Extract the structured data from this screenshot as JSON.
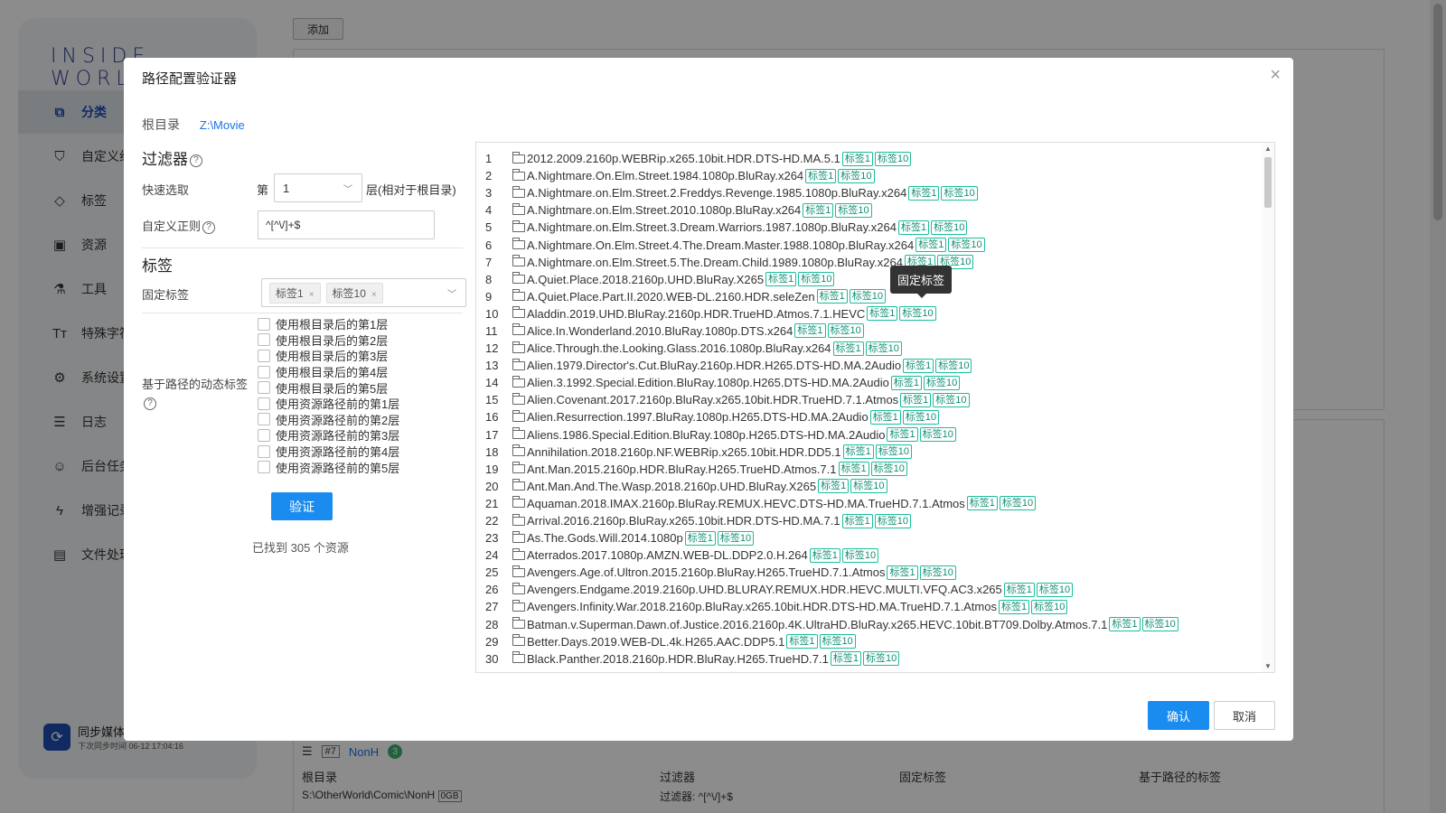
{
  "app": {
    "logo": "INSIDE WORLD",
    "nav": [
      {
        "label": "分类",
        "icon": "category-icon"
      },
      {
        "label": "自定义组",
        "icon": "custom-group-icon"
      },
      {
        "label": "标签",
        "icon": "tag-icon"
      },
      {
        "label": "资源",
        "icon": "image-icon"
      },
      {
        "label": "工具",
        "icon": "flask-icon"
      },
      {
        "label": "特殊字符",
        "icon": "text-icon"
      },
      {
        "label": "系统设置",
        "icon": "gear-icon"
      },
      {
        "label": "日志",
        "icon": "log-icon"
      },
      {
        "label": "后台任务",
        "icon": "bot-icon"
      },
      {
        "label": "增强记录",
        "icon": "bolt-icon"
      },
      {
        "label": "文件处理",
        "icon": "folder-icon"
      }
    ],
    "sync": {
      "title": "同步媒体",
      "subtitle": "下次同步时间 06-12 17:04:16"
    },
    "add_button": "添加",
    "card": {
      "index": "#7",
      "name": "NonH",
      "count": "3",
      "col1": "根目录",
      "col2": "过滤器",
      "col3": "固定标签",
      "col4": "基于路径的标签",
      "path": "S:\\OtherWorld\\Comic\\NonH",
      "size": "0GB",
      "filter": "过滤器: ^[^\\/]+$"
    }
  },
  "dialog": {
    "title": "路径配置验证器",
    "root_label": "根目录",
    "root_value": "Z:\\Movie",
    "filter_title": "过滤器",
    "quick_select_label": "快速选取",
    "level_prefix": "第",
    "level_value": "1",
    "level_suffix": "层(相对于根目录)",
    "regex_label": "自定义正则",
    "regex_value": "^[^\\/]+$",
    "tags_title": "标签",
    "fixed_tags_label": "固定标签",
    "fixed_tags": [
      "标签1",
      "标签10"
    ],
    "dynamic_tags_label": "基于路径的动态标签",
    "checkboxes": [
      "使用根目录后的第1层",
      "使用根目录后的第2层",
      "使用根目录后的第3层",
      "使用根目录后的第4层",
      "使用根目录后的第5层",
      "使用资源路径前的第1层",
      "使用资源路径前的第2层",
      "使用资源路径前的第3层",
      "使用资源路径前的第4层",
      "使用资源路径前的第5层"
    ],
    "verify_button": "验证",
    "found_text": "已找到 305 个资源",
    "tooltip": "固定标签",
    "ok_button": "确认",
    "cancel_button": "取消",
    "row_tags": [
      "标签1",
      "标签10"
    ],
    "items": [
      "2012.2009.2160p.WEBRip.x265.10bit.HDR.DTS-HD.MA.5.1",
      "A.Nightmare.On.Elm.Street.1984.1080p.BluRay.x264",
      "A.Nightmare.on.Elm.Street.2.Freddys.Revenge.1985.1080p.BluRay.x264",
      "A.Nightmare.on.Elm.Street.2010.1080p.BluRay.x264",
      "A.Nightmare.on.Elm.Street.3.Dream.Warriors.1987.1080p.BluRay.x264",
      "A.Nightmare.On.Elm.Street.4.The.Dream.Master.1988.1080p.BluRay.x264",
      "A.Nightmare.on.Elm.Street.5.The.Dream.Child.1989.1080p.BluRay.x264",
      "A.Quiet.Place.2018.2160p.UHD.BluRay.X265",
      "A.Quiet.Place.Part.II.2020.WEB-DL.2160.HDR.seleZen",
      "Aladdin.2019.UHD.BluRay.2160p.HDR.TrueHD.Atmos.7.1.HEVC",
      "Alice.In.Wonderland.2010.BluRay.1080p.DTS.x264",
      "Alice.Through.the.Looking.Glass.2016.1080p.BluRay.x264",
      "Alien.1979.Director's.Cut.BluRay.2160p.HDR.H265.DTS-HD.MA.2Audio",
      "Alien.3.1992.Special.Edition.BluRay.1080p.H265.DTS-HD.MA.2Audio",
      "Alien.Covenant.2017.2160p.BluRay.x265.10bit.HDR.TrueHD.7.1.Atmos",
      "Alien.Resurrection.1997.BluRay.1080p.H265.DTS-HD.MA.2Audio",
      "Aliens.1986.Special.Edition.BluRay.1080p.H265.DTS-HD.MA.2Audio",
      "Annihilation.2018.2160p.NF.WEBRip.x265.10bit.HDR.DD5.1",
      "Ant.Man.2015.2160p.HDR.BluRay.H265.TrueHD.Atmos.7.1",
      "Ant.Man.And.The.Wasp.2018.2160p.UHD.BluRay.X265",
      "Aquaman.2018.IMAX.2160p.BluRay.REMUX.HEVC.DTS-HD.MA.TrueHD.7.1.Atmos",
      "Arrival.2016.2160p.BluRay.x265.10bit.HDR.DTS-HD.MA.7.1",
      "As.The.Gods.Will.2014.1080p",
      "Aterrados.2017.1080p.AMZN.WEB-DL.DDP2.0.H.264",
      "Avengers.Age.of.Ultron.2015.2160p.BluRay.H265.TrueHD.7.1.Atmos",
      "Avengers.Endgame.2019.2160p.UHD.BLURAY.REMUX.HDR.HEVC.MULTI.VFQ.AC3.x265",
      "Avengers.Infinity.War.2018.2160p.BluRay.x265.10bit.HDR.DTS-HD.MA.TrueHD.7.1.Atmos",
      "Batman.v.Superman.Dawn.of.Justice.2016.2160p.4K.UltraHD.BluRay.x265.HEVC.10bit.BT709.Dolby.Atmos.7.1",
      "Better.Days.2019.WEB-DL.4k.H265.AAC.DDP5.1",
      "Black.Panther.2018.2160p.HDR.BluRay.H265.TrueHD.7.1"
    ]
  }
}
